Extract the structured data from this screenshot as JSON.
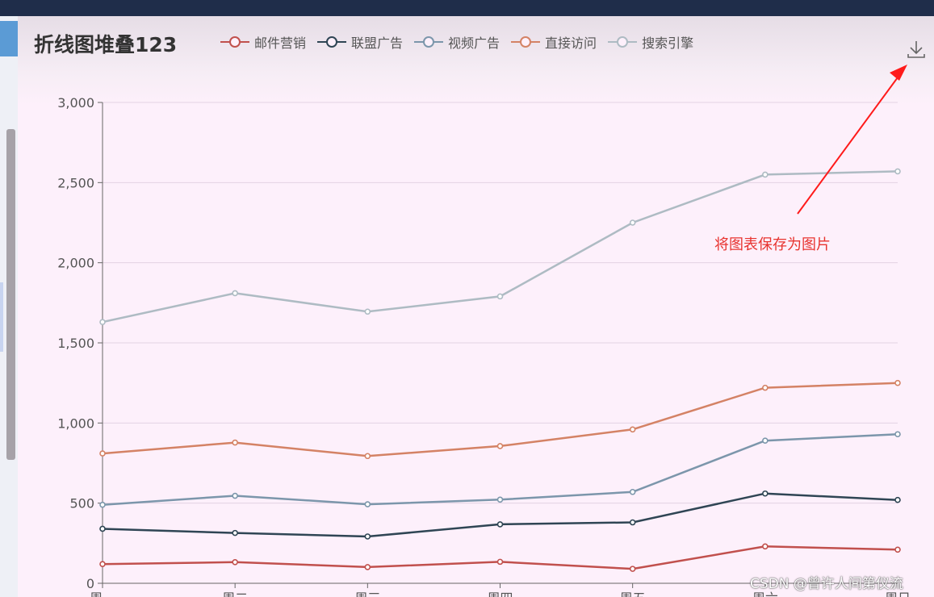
{
  "chart_data": {
    "type": "line",
    "title": "折线图堆叠123",
    "stacked": true,
    "categories": [
      "周一",
      "周二",
      "周三",
      "周四",
      "周五",
      "周六",
      "周日"
    ],
    "ylim": [
      0,
      3000
    ],
    "yticks": [
      0,
      500,
      1000,
      1500,
      2000,
      2500,
      3000
    ],
    "ytick_labels": [
      "0",
      "500",
      "1,000",
      "1,500",
      "2,000",
      "2,500",
      "3,000"
    ],
    "grid": true,
    "legend_position": "top",
    "series": [
      {
        "name": "邮件营销",
        "color": "#c1504d",
        "values": [
          120,
          132,
          101,
          134,
          90,
          230,
          210
        ]
      },
      {
        "name": "联盟广告",
        "color": "#2f4554",
        "values": [
          220,
          182,
          191,
          234,
          290,
          330,
          310
        ]
      },
      {
        "name": "视频广告",
        "color": "#7c96ab",
        "values": [
          150,
          232,
          201,
          154,
          190,
          330,
          410
        ]
      },
      {
        "name": "直接访问",
        "color": "#d48265",
        "values": [
          320,
          332,
          301,
          334,
          390,
          330,
          320
        ]
      },
      {
        "name": "搜索引擎",
        "color": "#aebbc3",
        "values": [
          820,
          932,
          901,
          934,
          1290,
          1330,
          1320
        ]
      }
    ]
  },
  "toolbox": {
    "icon": "download-icon"
  },
  "annotation": {
    "text": "将图表保存为图片",
    "color": "#e8332f"
  },
  "watermark": "CSDN @曾许人间第仪流"
}
